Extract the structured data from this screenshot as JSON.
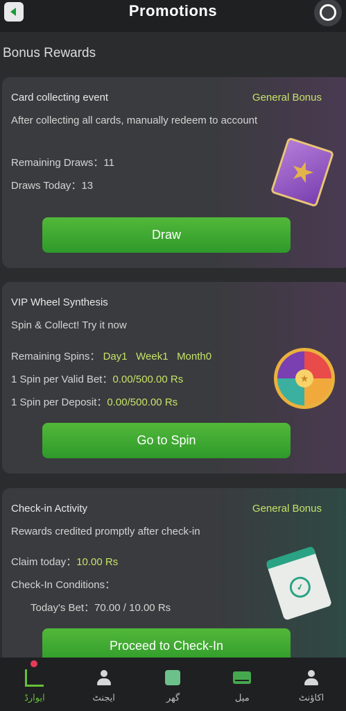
{
  "header": {
    "title": "Promotions",
    "back_icon": "back-arrow-icon",
    "support_icon": "support-icon"
  },
  "section_title": "Bonus Rewards",
  "cards": [
    {
      "title": "Card collecting event",
      "tag": "General Bonus",
      "subtitle": "After collecting all cards, manually redeem to account",
      "remaining_draws_label": "Remaining Draws：",
      "remaining_draws_value": "11",
      "draws_today_label": "Draws Today：",
      "draws_today_value": "13",
      "button_label": "Draw",
      "art": "card-icon"
    },
    {
      "title": "VIP Wheel Synthesis",
      "subtitle": "Spin & Collect! Try it now",
      "remaining_spins_label": "Remaining Spins：",
      "spins_day": "Day1",
      "spins_week": "Week1",
      "spins_month": "Month0",
      "valid_bet_label": "1 Spin per Valid Bet：",
      "valid_bet_value": "0.00/500.00 Rs",
      "deposit_label": "1 Spin per Deposit：",
      "deposit_value": "0.00/500.00 Rs",
      "button_label": "Go to Spin",
      "art": "wheel-icon"
    },
    {
      "title": "Check-in Activity",
      "tag": "General Bonus",
      "subtitle": "Rewards credited promptly after check-in",
      "claim_label": "Claim today：",
      "claim_value": "10.00 Rs",
      "conditions_label": "Check-In Conditions：",
      "todays_bet_label": "Today's Bet：",
      "todays_bet_value": "70.00 / 10.00 Rs",
      "button_label": "Proceed to Check-In",
      "art": "calendar-icon"
    }
  ],
  "bottom_nav": [
    {
      "label": "ایوارڈ",
      "icon": "rewards-icon",
      "active": true
    },
    {
      "label": "ایجنٹ",
      "icon": "agent-icon",
      "active": false
    },
    {
      "label": "گھر",
      "icon": "home-icon",
      "active": false
    },
    {
      "label": "میل",
      "icon": "mail-icon",
      "active": false
    },
    {
      "label": "اکاؤنٹ",
      "icon": "account-icon",
      "active": false
    }
  ],
  "colors": {
    "accent_green": "#3aa72c",
    "highlight": "#c6e36a",
    "background": "#2a2c2e",
    "card": "#3a3b3e"
  }
}
